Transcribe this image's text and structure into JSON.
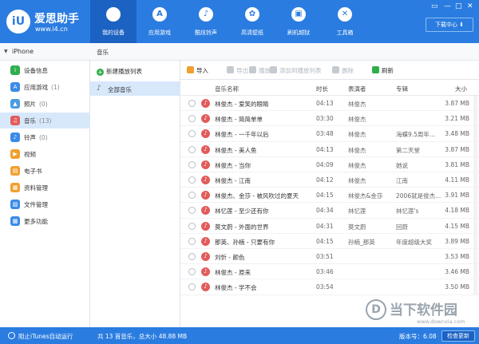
{
  "app": {
    "logo_mark": "iU",
    "title": "爱思助手",
    "url": "www.i4.cn"
  },
  "nav": [
    {
      "label": "我的设备",
      "icon": "apple-icon",
      "glyph": "",
      "active": true
    },
    {
      "label": "应用游戏",
      "icon": "app-store-icon",
      "glyph": "A",
      "active": false
    },
    {
      "label": "酷炫铃声",
      "icon": "bell-icon",
      "glyph": "♪",
      "active": false
    },
    {
      "label": "高清壁纸",
      "icon": "flower-icon",
      "glyph": "✿",
      "active": false
    },
    {
      "label": "刷机越狱",
      "icon": "box-icon",
      "glyph": "▣",
      "active": false
    },
    {
      "label": "工具箱",
      "icon": "tools-icon",
      "glyph": "✕",
      "active": false
    }
  ],
  "window_controls": [
    "▭",
    "—",
    "□",
    "✕"
  ],
  "download_button": "下载中心 ⬇",
  "device": {
    "name": "iPhone"
  },
  "sidebar": {
    "items": [
      {
        "label": "设备信息",
        "count": "",
        "icon": "info-icon",
        "glyph": "i",
        "color": "#2fae4e",
        "active": false
      },
      {
        "label": "应用游戏",
        "count": "(1)",
        "icon": "apps-icon",
        "glyph": "A",
        "color": "#3b8be6",
        "active": false
      },
      {
        "label": "照片",
        "count": "(0)",
        "icon": "photo-icon",
        "glyph": "▲",
        "color": "#4b9be0",
        "active": false
      },
      {
        "label": "音乐",
        "count": "(13)",
        "icon": "music-icon",
        "glyph": "♫",
        "color": "#e25b5b",
        "active": true
      },
      {
        "label": "铃声",
        "count": "(0)",
        "icon": "bell-icon",
        "glyph": "♪",
        "color": "#3b8be6",
        "active": false
      },
      {
        "label": "视频",
        "count": "",
        "icon": "video-icon",
        "glyph": "▶",
        "color": "#f0a030",
        "active": false
      },
      {
        "label": "电子书",
        "count": "",
        "icon": "book-icon",
        "glyph": "▤",
        "color": "#f0a030",
        "active": false
      },
      {
        "label": "资料管理",
        "count": "",
        "icon": "contacts-icon",
        "glyph": "▦",
        "color": "#f0a030",
        "active": false
      },
      {
        "label": "文件管理",
        "count": "",
        "icon": "folder-icon",
        "glyph": "▨",
        "color": "#3b8be6",
        "active": false
      },
      {
        "label": "更多功能",
        "count": "",
        "icon": "more-icon",
        "glyph": "▩",
        "color": "#3b8be6",
        "active": false
      }
    ]
  },
  "music": {
    "tab": "音乐",
    "new_playlist": "新建播放列表",
    "all_music": "全部音乐"
  },
  "toolbar": [
    {
      "label": "导入",
      "icon": "import-icon",
      "enabled": true,
      "color": "#f0a030"
    },
    {
      "label": "导出",
      "icon": "export-icon",
      "enabled": false,
      "color": "#c5cad0"
    },
    {
      "label": "播放",
      "icon": "play-icon",
      "enabled": false,
      "color": "#c5cad0"
    },
    {
      "label": "添加到播放列表",
      "icon": "add-to-playlist-icon",
      "enabled": false,
      "color": "#c5cad0"
    },
    {
      "label": "删除",
      "icon": "delete-icon",
      "enabled": false,
      "color": "#c5cad0"
    },
    {
      "label": "刷新",
      "icon": "refresh-icon",
      "enabled": true,
      "color": "#2fae4e"
    }
  ],
  "table": {
    "headers": {
      "name": "音乐名称",
      "time": "时长",
      "artist": "表演者",
      "album": "专辑",
      "size": "大小"
    },
    "rows": [
      {
        "name": "林俊杰 - 爱笑的眼睛",
        "time": "04:13",
        "artist": "林俊杰",
        "album": "",
        "size": "3.87 MB"
      },
      {
        "name": "林俊杰 - 简简单单",
        "time": "03:30",
        "artist": "林俊杰",
        "album": "",
        "size": "3.21 MB"
      },
      {
        "name": "林俊杰 - 一千年以后",
        "time": "03:48",
        "artist": "林俊杰",
        "album": "海蝶9.5周年...",
        "size": "3.48 MB"
      },
      {
        "name": "林俊杰 - 美人鱼",
        "time": "04:13",
        "artist": "林俊杰",
        "album": "第二天堂",
        "size": "3.87 MB"
      },
      {
        "name": "林俊杰 - 当你",
        "time": "04:09",
        "artist": "林俊杰",
        "album": "她说",
        "size": "3.81 MB"
      },
      {
        "name": "林俊杰 - 江南",
        "time": "04:12",
        "artist": "林俊杰",
        "album": "江南",
        "size": "4.11 MB"
      },
      {
        "name": "林俊杰、金莎 - 被风吹过的夏天",
        "time": "04:15",
        "artist": "林俊杰&金莎",
        "album": "2006就是俊杰...",
        "size": "3.91 MB"
      },
      {
        "name": "林忆莲 - 至少还有你",
        "time": "04:34",
        "artist": "林忆莲",
        "album": "林忆莲's",
        "size": "4.18 MB"
      },
      {
        "name": "莫文蔚 - 外面的世界",
        "time": "04:31",
        "artist": "莫文蔚",
        "album": "回蔚",
        "size": "4.15 MB"
      },
      {
        "name": "那英、孙楠 - 只要有你",
        "time": "04:15",
        "artist": "孙楠_那英",
        "album": "年度超级大奖",
        "size": "3.89 MB"
      },
      {
        "name": "刘忻 - 颜色",
        "time": "03:51",
        "artist": "",
        "album": "",
        "size": "3.53 MB"
      },
      {
        "name": "林俊杰 - 原来",
        "time": "03:46",
        "artist": "",
        "album": "",
        "size": "3.46 MB"
      },
      {
        "name": "林俊杰 - 学不会",
        "time": "03:54",
        "artist": "",
        "album": "",
        "size": "3.50 MB"
      }
    ]
  },
  "watermark": {
    "mark": "D",
    "text": "当下软件园",
    "url": "www.downxia.com"
  },
  "status": {
    "itunes": "阻止iTunes自动运行",
    "summary": "共 13 首音乐，总大小 48.88 MB",
    "version": "版本号：6.08",
    "update_button": "检查更新"
  }
}
